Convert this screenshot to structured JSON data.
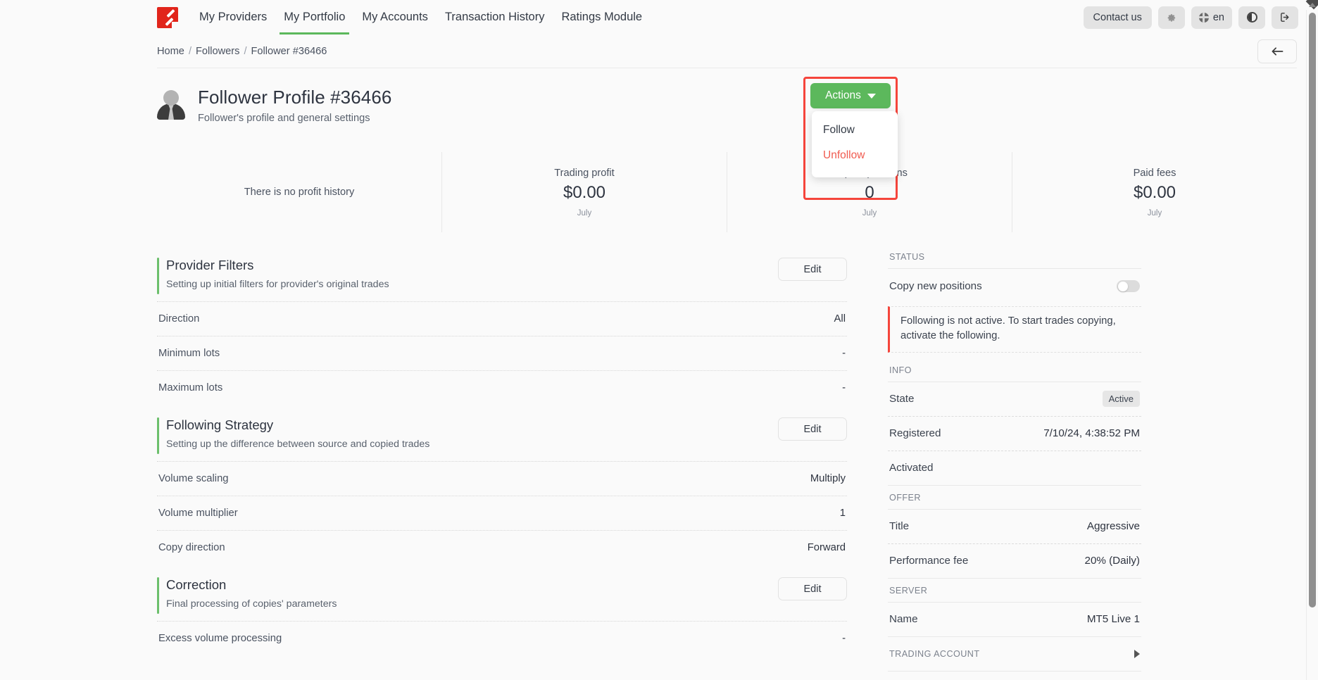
{
  "topnav": {
    "logo_icon": "brand-logo-icon",
    "links": [
      {
        "label": "My Providers",
        "active": false
      },
      {
        "label": "My Portfolio",
        "active": true
      },
      {
        "label": "My Accounts",
        "active": false
      },
      {
        "label": "Transaction History",
        "active": false
      },
      {
        "label": "Ratings Module",
        "active": false
      }
    ],
    "contact_label": "Contact us",
    "settings_icon": "gear-icon",
    "language_icon": "globe-icon",
    "language_label": "en",
    "theme_icon": "contrast-icon",
    "logout_icon": "logout-icon"
  },
  "breadcrumb": {
    "home": "Home",
    "sep": "/",
    "followers": "Followers",
    "current": "Follower #36466",
    "back_icon": "arrow-left-icon"
  },
  "profile": {
    "avatar_icon": "user-avatar-icon",
    "title": "Follower Profile #36466",
    "subtitle": "Follower's profile and general settings"
  },
  "actions": {
    "button_label": "Actions",
    "chevron_icon": "chevron-down-icon",
    "items": [
      {
        "label": "Follow",
        "style": "normal"
      },
      {
        "label": "Unfollow",
        "style": "danger"
      }
    ],
    "highlight_color": "#f5453c",
    "button_color": "#5cb85c"
  },
  "stats": {
    "no_history": "There is no profit history",
    "cells": [
      {
        "label": "Trading profit",
        "value": "$0.00",
        "period": "July"
      },
      {
        "label": "Copied positions",
        "value": "0",
        "period": "July"
      },
      {
        "label": "Paid fees",
        "value": "$0.00",
        "period": "July"
      }
    ]
  },
  "sections": [
    {
      "title": "Provider Filters",
      "subtitle": "Setting up initial filters for provider's original trades",
      "edit_label": "Edit",
      "rows": [
        {
          "key": "Direction",
          "value": "All"
        },
        {
          "key": "Minimum lots",
          "value": "-"
        },
        {
          "key": "Maximum lots",
          "value": "-"
        }
      ]
    },
    {
      "title": "Following Strategy",
      "subtitle": "Setting up the difference between source and copied trades",
      "edit_label": "Edit",
      "rows": [
        {
          "key": "Volume scaling",
          "value": "Multiply"
        },
        {
          "key": "Volume multiplier",
          "value": "1"
        },
        {
          "key": "Copy direction",
          "value": "Forward"
        }
      ]
    },
    {
      "title": "Correction",
      "subtitle": "Final processing of copies' parameters",
      "edit_label": "Edit",
      "rows": [
        {
          "key": "Excess volume processing",
          "value": "-"
        }
      ]
    }
  ],
  "sidebar": {
    "status": {
      "label": "STATUS",
      "copy_label": "Copy new positions",
      "toggle_on": false,
      "alert": "Following is not active. To start trades copying, activate the following."
    },
    "info": {
      "label": "INFO",
      "rows": [
        {
          "key": "State",
          "value": "Active",
          "badge": true
        },
        {
          "key": "Registered",
          "value": "7/10/24, 4:38:52 PM",
          "badge": false
        },
        {
          "key": "Activated",
          "value": "",
          "badge": false
        }
      ]
    },
    "offer": {
      "label": "OFFER",
      "rows": [
        {
          "key": "Title",
          "value": "Aggressive"
        },
        {
          "key": "Performance fee",
          "value": "20% (Daily)"
        }
      ]
    },
    "server": {
      "label": "SERVER",
      "rows": [
        {
          "key": "Name",
          "value": "MT5 Live 1"
        }
      ]
    },
    "trading_account": {
      "label": "TRADING ACCOUNT",
      "chevron_icon": "chevron-right-icon"
    }
  }
}
